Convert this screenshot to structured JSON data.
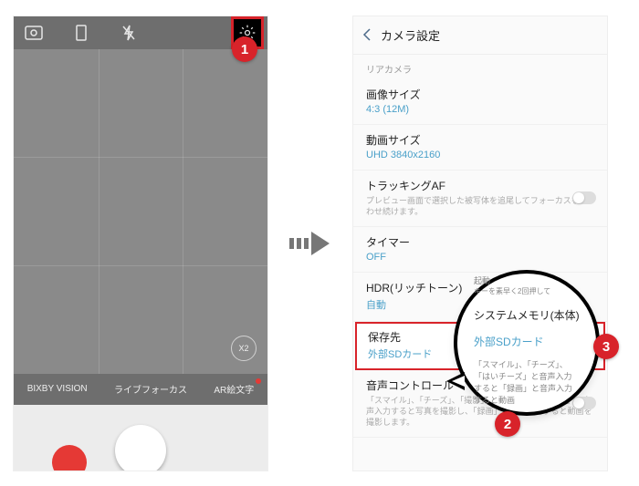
{
  "steps": {
    "one": "1",
    "two": "2",
    "three": "3"
  },
  "camera": {
    "zoom": "X2",
    "modes": {
      "bixby": "BIXBY VISION",
      "live": "ライブフォーカス",
      "ar": "AR絵文字"
    }
  },
  "settings": {
    "header": "カメラ設定",
    "rear_section": "リアカメラ",
    "image_size": {
      "title": "画像サイズ",
      "value": "4:3 (12M)"
    },
    "video_size": {
      "title": "動画サイズ",
      "value": "UHD 3840x2160"
    },
    "tracking_af": {
      "title": "トラッキングAF",
      "desc": "プレビュー画面で選択した被写体を追尾してフォーカスを合わせ続けます。"
    },
    "timer": {
      "title": "タイマー",
      "value": "OFF"
    },
    "hdr": {
      "title": "HDR(リッチトーン)",
      "value": "自動"
    },
    "quicklaunch": {
      "title": "起動",
      "hint": "キーを素早く2回押して"
    },
    "storage": {
      "title": "保存先",
      "value": "外部SDカード"
    },
    "voice": {
      "title": "音声コントロール",
      "desc": "「スマイル」、「チーズ」、「撮影」、または「はいチーズ」と音声入力すると写真を撮影し、「録画」と音声入力すると動画を撮影します。"
    }
  },
  "popup": {
    "tip_partial": "「スマイル」、「チーズ」、「はいチーズ」と音声入力すると「録画」と音声入力すると動画",
    "opt_internal": "システムメモリ(本体)",
    "opt_sd": "外部SDカード"
  }
}
